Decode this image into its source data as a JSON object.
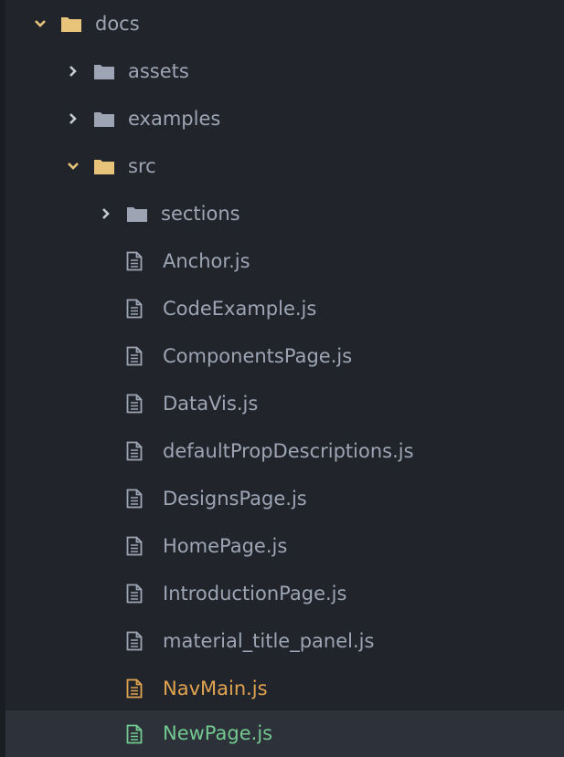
{
  "colors": {
    "background": "#21252b",
    "text": "#9da5b4",
    "folder_open": "#e8c47a",
    "folder_closed": "#9da5b4",
    "modified": "#e0a351",
    "added": "#73c990",
    "selected_row": "#2c313a"
  },
  "tree": {
    "docs": {
      "label": "docs",
      "icon": "folder-open-icon",
      "expanded": true
    },
    "assets": {
      "label": "assets",
      "icon": "folder-icon",
      "expanded": false
    },
    "examples": {
      "label": "examples",
      "icon": "folder-icon",
      "expanded": false
    },
    "src": {
      "label": "src",
      "icon": "folder-open-icon",
      "expanded": true
    },
    "sections": {
      "label": "sections",
      "icon": "folder-icon",
      "expanded": false
    },
    "files": [
      {
        "label": "Anchor.js",
        "status": ""
      },
      {
        "label": "CodeExample.js",
        "status": ""
      },
      {
        "label": "ComponentsPage.js",
        "status": ""
      },
      {
        "label": "DataVis.js",
        "status": ""
      },
      {
        "label": "defaultPropDescriptions.js",
        "status": ""
      },
      {
        "label": "DesignsPage.js",
        "status": ""
      },
      {
        "label": "HomePage.js",
        "status": ""
      },
      {
        "label": "IntroductionPage.js",
        "status": ""
      },
      {
        "label": "material_title_panel.js",
        "status": ""
      },
      {
        "label": "NavMain.js",
        "status": "modified"
      },
      {
        "label": "NewPage.js",
        "status": "added"
      }
    ]
  }
}
